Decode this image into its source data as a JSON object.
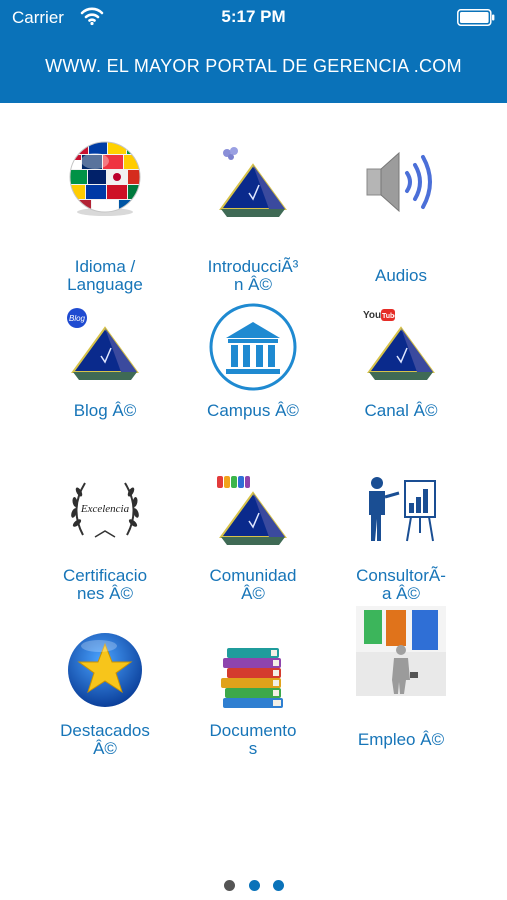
{
  "status_bar": {
    "carrier": "Carrier",
    "time": "5:17 PM"
  },
  "header": {
    "title": "WWW. EL MAYOR PORTAL DE GERENCIA .COM"
  },
  "tiles": [
    {
      "label1": "Idioma /",
      "label2": "Language",
      "icon": "globe-flags-icon"
    },
    {
      "label1": "IntroducciÃ³",
      "label2": "n Â©",
      "icon": "pyramid-icon"
    },
    {
      "label1": "Audios",
      "label2": "",
      "icon": "speaker-icon"
    },
    {
      "label1": "Blog Â©",
      "label2": "",
      "icon": "pyramid-blog-icon"
    },
    {
      "label1": "Campus Â©",
      "label2": "",
      "icon": "institution-icon"
    },
    {
      "label1": "Canal Â©",
      "label2": "",
      "icon": "pyramid-youtube-icon"
    },
    {
      "label1": "Certificacio",
      "label2": "nes Â©",
      "icon": "laurel-excellence-icon"
    },
    {
      "label1": "Comunidad",
      "label2": "Â©",
      "icon": "pyramid-community-icon"
    },
    {
      "label1": "ConsultorÃ-",
      "label2": "a Â©",
      "icon": "presenter-chart-icon"
    },
    {
      "label1": "Destacados",
      "label2": "Â©",
      "icon": "star-icon"
    },
    {
      "label1": "Documento",
      "label2": "s",
      "icon": "books-icon"
    },
    {
      "label1": "Empleo Â©",
      "label2": "",
      "icon": "doors-businessman-icon"
    }
  ],
  "page_indicator": {
    "pages": 3,
    "current": 1
  },
  "colors": {
    "header": "#0a72b9",
    "label": "#1775b8",
    "dot_inactive": "#555555",
    "dot_active": "#0a72b9"
  }
}
